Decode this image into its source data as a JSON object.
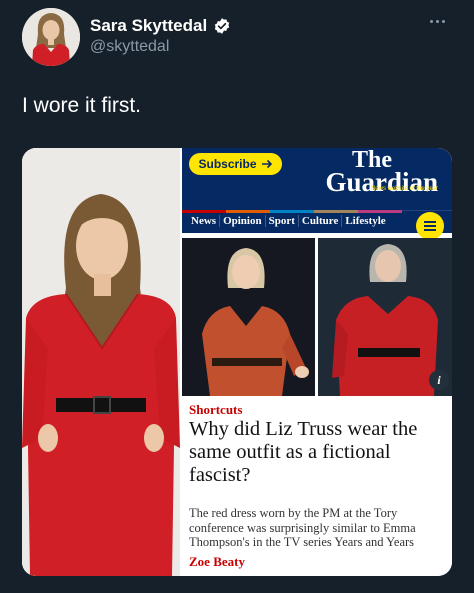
{
  "author": {
    "name": "Sara Skyttedal",
    "handle": "@skyttedal",
    "verified": true
  },
  "tweet": {
    "text": "I wore it first."
  },
  "guardian": {
    "subscribe_label": "Subscribe",
    "logo_line1": "The",
    "logo_line2": "Guardian",
    "tagline": "News website of the year",
    "nav": [
      "News",
      "Opinion",
      "Sport",
      "Culture",
      "Lifestyle"
    ],
    "nav_colors": [
      "#c70000",
      "#e05e00",
      "#0084c6",
      "#a1845c",
      "#bb3b80"
    ],
    "kicker": "Shortcuts",
    "headline": "Why did Liz Truss wear the same outfit as a fictional fascist?",
    "standfirst": "The red dress worn by the PM at the Tory conference was surprisingly similar to Emma Thompson's in the TV series Years and Years",
    "byline": "Zoe Beaty",
    "info_label": "i"
  },
  "colors": {
    "background": "#15202b",
    "guardian_blue": "#052962",
    "guardian_yellow": "#ffe500",
    "guardian_red": "#c70000",
    "dress_red": "#d01f26"
  },
  "icons": {
    "verified": "verified-badge-icon",
    "more": "more-options-icon",
    "arrow": "arrow-right-icon",
    "menu": "hamburger-menu-icon",
    "info": "info-icon"
  }
}
